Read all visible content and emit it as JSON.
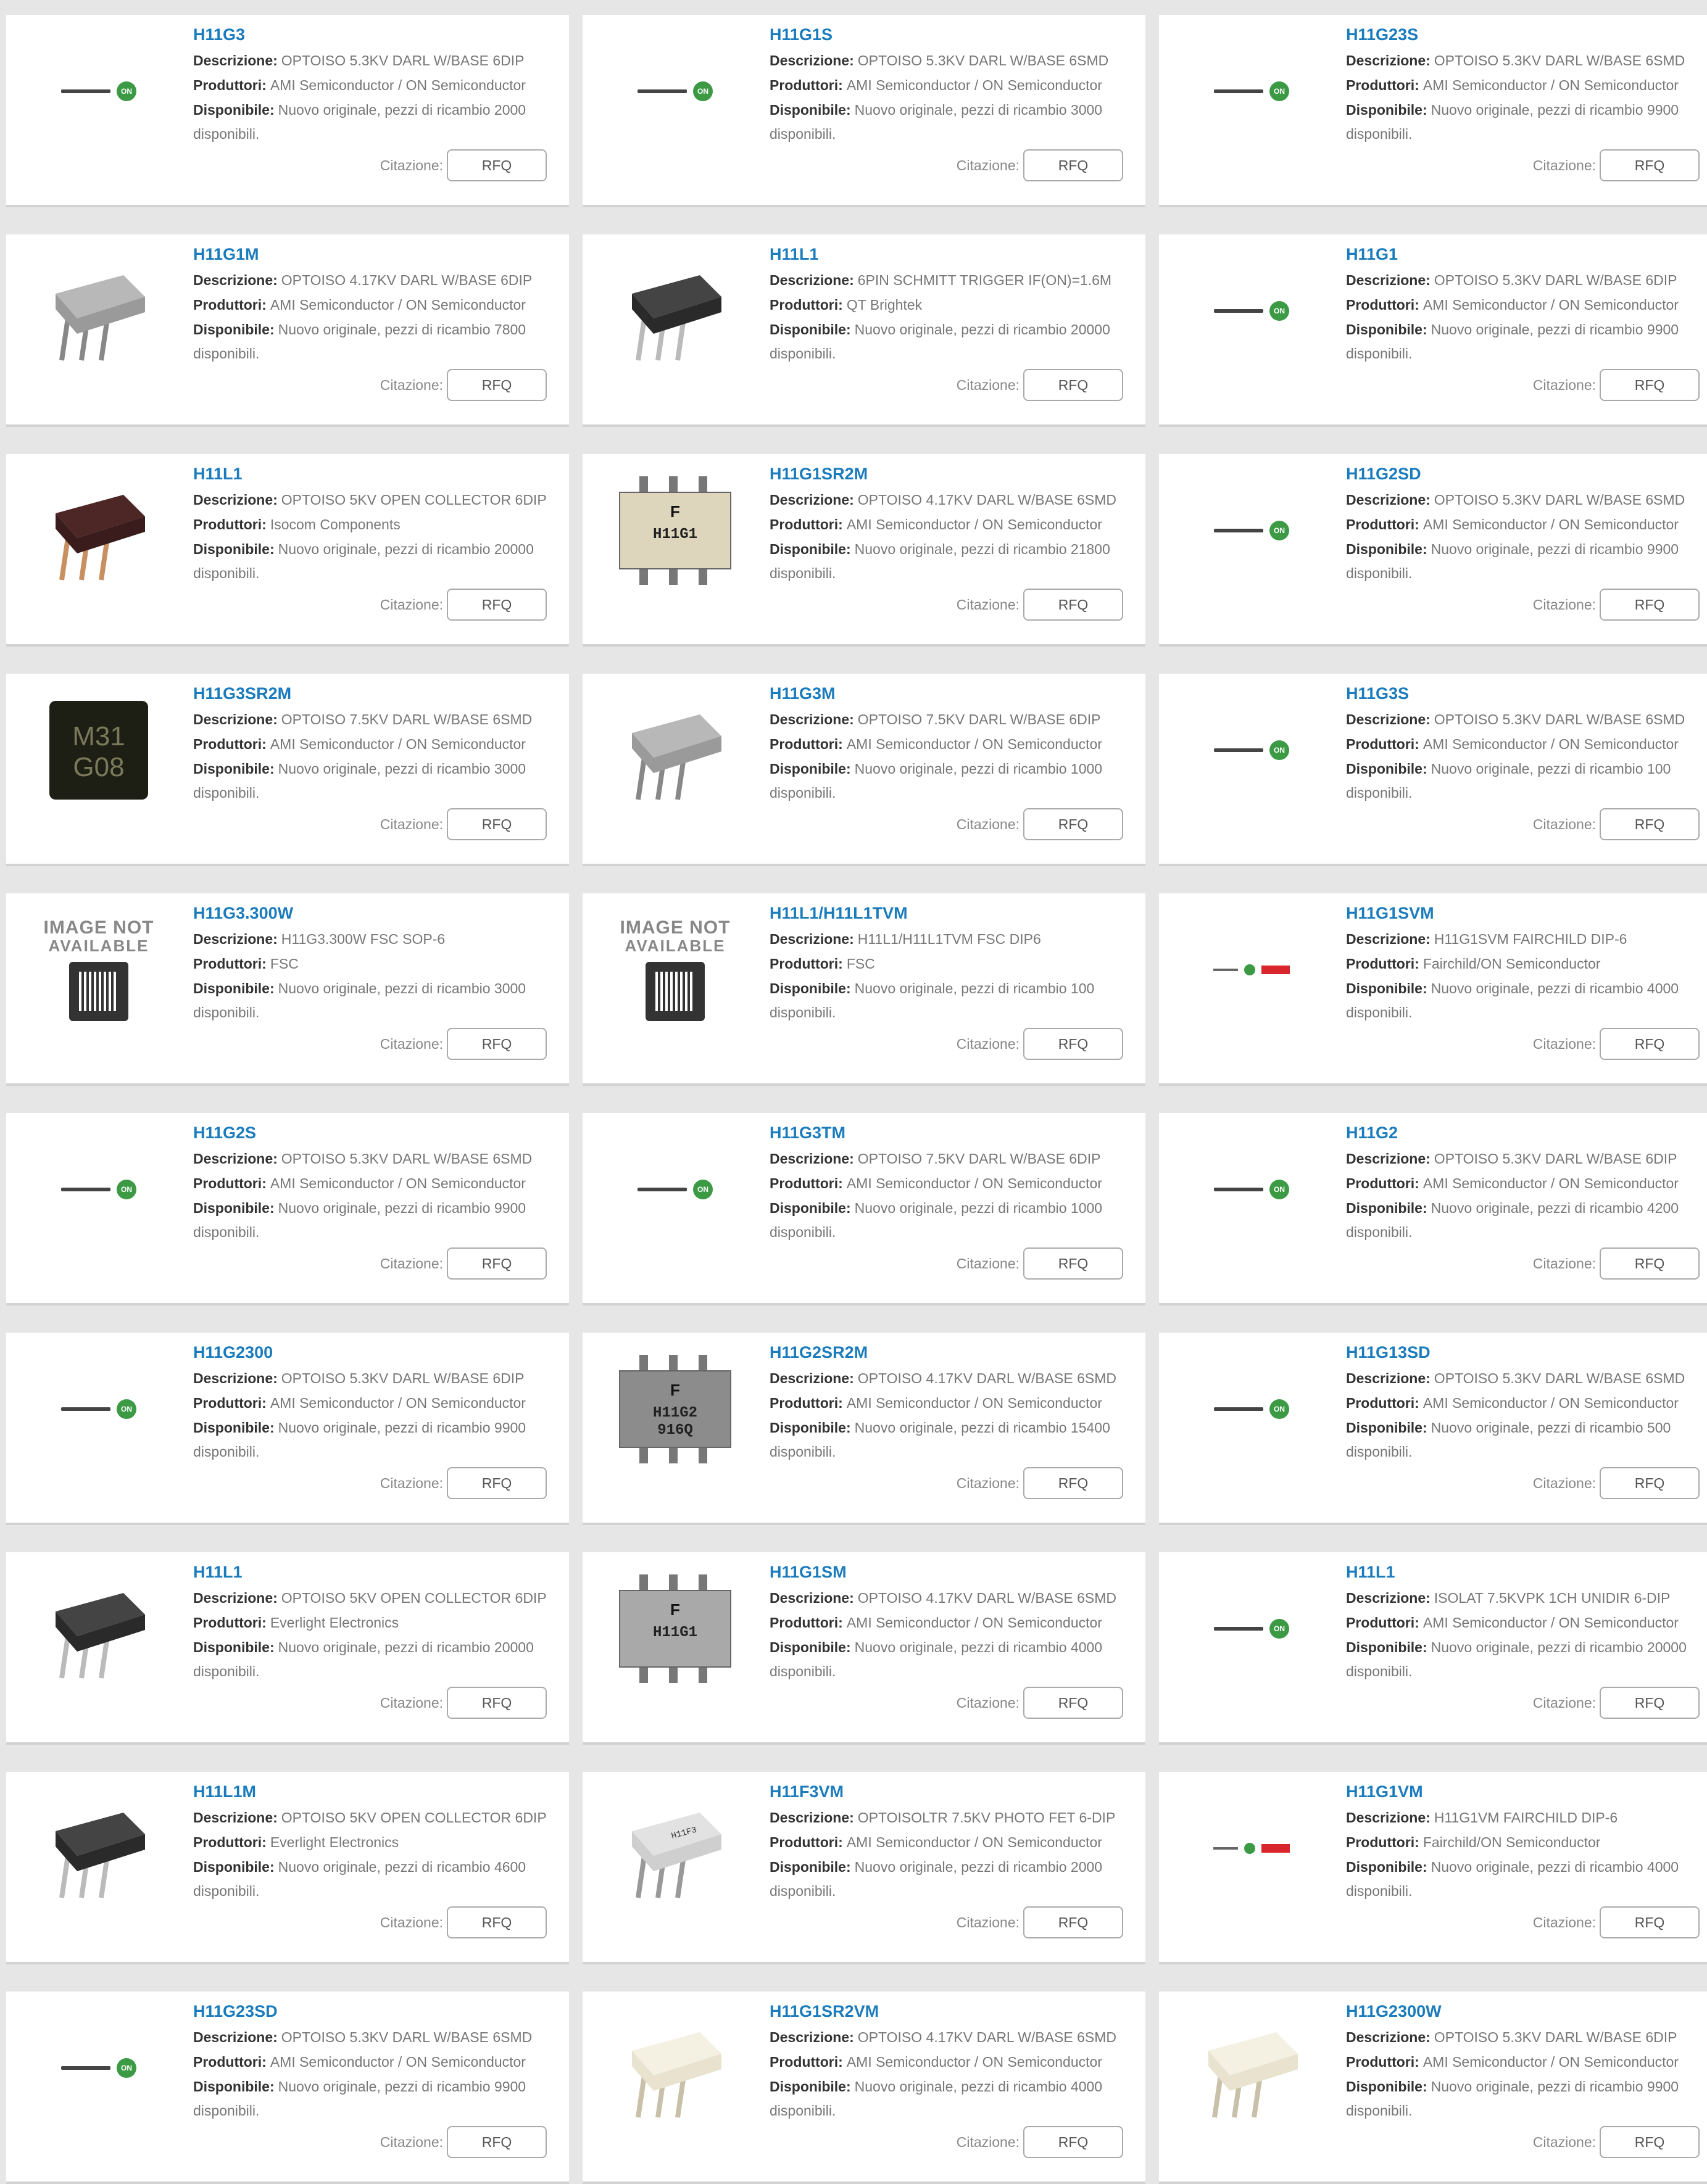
{
  "labels": {
    "desc": "Descrizione:",
    "prod": "Produttori:",
    "avail": "Disponibile:",
    "quote": "Citazione:",
    "rfq": "RFQ",
    "available_suffix": "disponibili."
  },
  "not_available": {
    "line1": "IMAGE NOT",
    "line2": "AVAILABLE"
  },
  "products": [
    {
      "name": "H11G3",
      "desc": "OPTOISO 5.3KV DARL W/BASE 6DIP",
      "prod": "AMI Semiconductor / ON Semiconductor",
      "avail": "Nuovo originale, pezzi di ricambio 2000",
      "image": "on-semi-logo"
    },
    {
      "name": "H11G1S",
      "desc": "OPTOISO 5.3KV DARL W/BASE 6SMD",
      "prod": "AMI Semiconductor / ON Semiconductor",
      "avail": "Nuovo originale, pezzi di ricambio 3000",
      "image": "on-semi-logo"
    },
    {
      "name": "H11G23S",
      "desc": "OPTOISO 5.3KV DARL W/BASE 6SMD",
      "prod": "AMI Semiconductor / ON Semiconductor",
      "avail": "Nuovo originale, pezzi di ricambio 9900",
      "image": "on-semi-logo"
    },
    {
      "name": "H11G1M",
      "desc": "OPTOISO 4.17KV DARL W/BASE 6DIP",
      "prod": "AMI Semiconductor / ON Semiconductor",
      "avail": "Nuovo originale, pezzi di ricambio 7800",
      "image": "dip-gray"
    },
    {
      "name": "H11L1",
      "desc": "6PIN SCHMITT TRIGGER IF(ON)=1.6M",
      "prod": "QT Brightek",
      "avail": "Nuovo originale, pezzi di ricambio 20000",
      "image": "dip-black"
    },
    {
      "name": "H11G1",
      "desc": "OPTOISO 5.3KV DARL W/BASE 6DIP",
      "prod": "AMI Semiconductor / ON Semiconductor",
      "avail": "Nuovo originale, pezzi di ricambio 9900",
      "image": "on-semi-logo"
    },
    {
      "name": "H11L1",
      "desc": "OPTOISO 5KV OPEN COLLECTOR 6DIP",
      "prod": "Isocom Components",
      "avail": "Nuovo originale, pezzi di ricambio 20000",
      "image": "dip-dark-red"
    },
    {
      "name": "H11G1SR2M",
      "desc": "OPTOISO 4.17KV DARL W/BASE 6SMD",
      "prod": "AMI Semiconductor / ON Semiconductor",
      "avail": "Nuovo originale, pezzi di ricambio 21800",
      "image": "smd-beige",
      "chip_text": "H11G1"
    },
    {
      "name": "H11G2SD",
      "desc": "OPTOISO 5.3KV DARL W/BASE 6SMD",
      "prod": "AMI Semiconductor / ON Semiconductor",
      "avail": "Nuovo originale, pezzi di ricambio 9900",
      "image": "on-semi-logo"
    },
    {
      "name": "H11G3SR2M",
      "desc": "OPTOISO 7.5KV DARL W/BASE 6SMD",
      "prod": "AMI Semiconductor / ON Semiconductor",
      "avail": "Nuovo originale, pezzi di ricambio 3000",
      "image": "qfn-black",
      "chip_text": "M31 G08"
    },
    {
      "name": "H11G3M",
      "desc": "OPTOISO 7.5KV DARL W/BASE 6DIP",
      "prod": "AMI Semiconductor / ON Semiconductor",
      "avail": "Nuovo originale, pezzi di ricambio 1000",
      "image": "dip-gray"
    },
    {
      "name": "H11G3S",
      "desc": "OPTOISO 5.3KV DARL W/BASE 6SMD",
      "prod": "AMI Semiconductor / ON Semiconductor",
      "avail": "Nuovo originale, pezzi di ricambio 100",
      "image": "on-semi-logo"
    },
    {
      "name": "H11G3.300W",
      "desc": "H11G3.300W FSC SOP-6",
      "prod": "FSC",
      "avail": "Nuovo originale, pezzi di ricambio 3000",
      "image": "not-available"
    },
    {
      "name": "H11L1/H11L1TVM",
      "desc": "H11L1/H11L1TVM FSC DIP6",
      "prod": "FSC",
      "avail": "Nuovo originale, pezzi di ricambio 100",
      "image": "not-available"
    },
    {
      "name": "H11G1SVM",
      "desc": "H11G1SVM FAIRCHILD DIP-6",
      "prod": "Fairchild/ON Semiconductor",
      "avail": "Nuovo originale, pezzi di ricambio 4000",
      "image": "fairchild-on-logo"
    },
    {
      "name": "H11G2S",
      "desc": "OPTOISO 5.3KV DARL W/BASE 6SMD",
      "prod": "AMI Semiconductor / ON Semiconductor",
      "avail": "Nuovo originale, pezzi di ricambio 9900",
      "image": "on-semi-logo"
    },
    {
      "name": "H11G3TM",
      "desc": "OPTOISO 7.5KV DARL W/BASE 6DIP",
      "prod": "AMI Semiconductor / ON Semiconductor",
      "avail": "Nuovo originale, pezzi di ricambio 1000",
      "image": "on-semi-logo"
    },
    {
      "name": "H11G2",
      "desc": "OPTOISO 5.3KV DARL W/BASE 6DIP",
      "prod": "AMI Semiconductor / ON Semiconductor",
      "avail": "Nuovo originale, pezzi di ricambio 4200",
      "image": "on-semi-logo"
    },
    {
      "name": "H11G2300",
      "desc": "OPTOISO 5.3KV DARL W/BASE 6DIP",
      "prod": "AMI Semiconductor / ON Semiconductor",
      "avail": "Nuovo originale, pezzi di ricambio 9900",
      "image": "on-semi-logo"
    },
    {
      "name": "H11G2SR2M",
      "desc": "OPTOISO 4.17KV DARL W/BASE 6SMD",
      "prod": "AMI Semiconductor / ON Semiconductor",
      "avail": "Nuovo originale, pezzi di ricambio 15400",
      "image": "smd-gray",
      "chip_text": "H11G2 916Q"
    },
    {
      "name": "H11G13SD",
      "desc": "OPTOISO 5.3KV DARL W/BASE 6SMD",
      "prod": "AMI Semiconductor / ON Semiconductor",
      "avail": "Nuovo originale, pezzi di ricambio 500",
      "image": "on-semi-logo"
    },
    {
      "name": "H11L1",
      "desc": "OPTOISO 5KV OPEN COLLECTOR 6DIP",
      "prod": "Everlight Electronics",
      "avail": "Nuovo originale, pezzi di ricambio 20000",
      "image": "dip-black"
    },
    {
      "name": "H11G1SM",
      "desc": "OPTOISO 4.17KV DARL W/BASE 6SMD",
      "prod": "AMI Semiconductor / ON Semiconductor",
      "avail": "Nuovo originale, pezzi di ricambio 4000",
      "image": "smd-light",
      "chip_text": "H11G1"
    },
    {
      "name": "H11L1",
      "desc": "ISOLAT 7.5KVPK 1CH UNIDIR 6-DIP",
      "prod": "AMI Semiconductor / ON Semiconductor",
      "avail": "Nuovo originale, pezzi di ricambio 20000",
      "image": "on-semi-logo"
    },
    {
      "name": "H11L1M",
      "desc": "OPTOISO 5KV OPEN COLLECTOR 6DIP",
      "prod": "Everlight Electronics",
      "avail": "Nuovo originale, pezzi di ricambio 4600",
      "image": "dip-black"
    },
    {
      "name": "H11F3VM",
      "desc": "OPTOISOLTR 7.5KV PHOTO FET 6-DIP",
      "prod": "AMI Semiconductor / ON Semiconductor",
      "avail": "Nuovo originale, pezzi di ricambio 2000",
      "image": "dip-light",
      "chip_text": "H11F3"
    },
    {
      "name": "H11G1VM",
      "desc": "H11G1VM FAIRCHILD DIP-6",
      "prod": "Fairchild/ON Semiconductor",
      "avail": "Nuovo originale, pezzi di ricambio 4000",
      "image": "fairchild-on-logo"
    },
    {
      "name": "H11G23SD",
      "desc": "OPTOISO 5.3KV DARL W/BASE 6SMD",
      "prod": "AMI Semiconductor / ON Semiconductor",
      "avail": "Nuovo originale, pezzi di ricambio 9900",
      "image": "on-semi-logo"
    },
    {
      "name": "H11G1SR2VM",
      "desc": "OPTOISO 4.17KV DARL W/BASE 6SMD",
      "prod": "AMI Semiconductor / ON Semiconductor",
      "avail": "Nuovo originale, pezzi di ricambio 4000",
      "image": "dip-cream"
    },
    {
      "name": "H11G2300W",
      "desc": "OPTOISO 5.3KV DARL W/BASE 6DIP",
      "prod": "AMI Semiconductor / ON Semiconductor",
      "avail": "Nuovo originale, pezzi di ricambio 9900",
      "image": "dip-cream"
    }
  ]
}
